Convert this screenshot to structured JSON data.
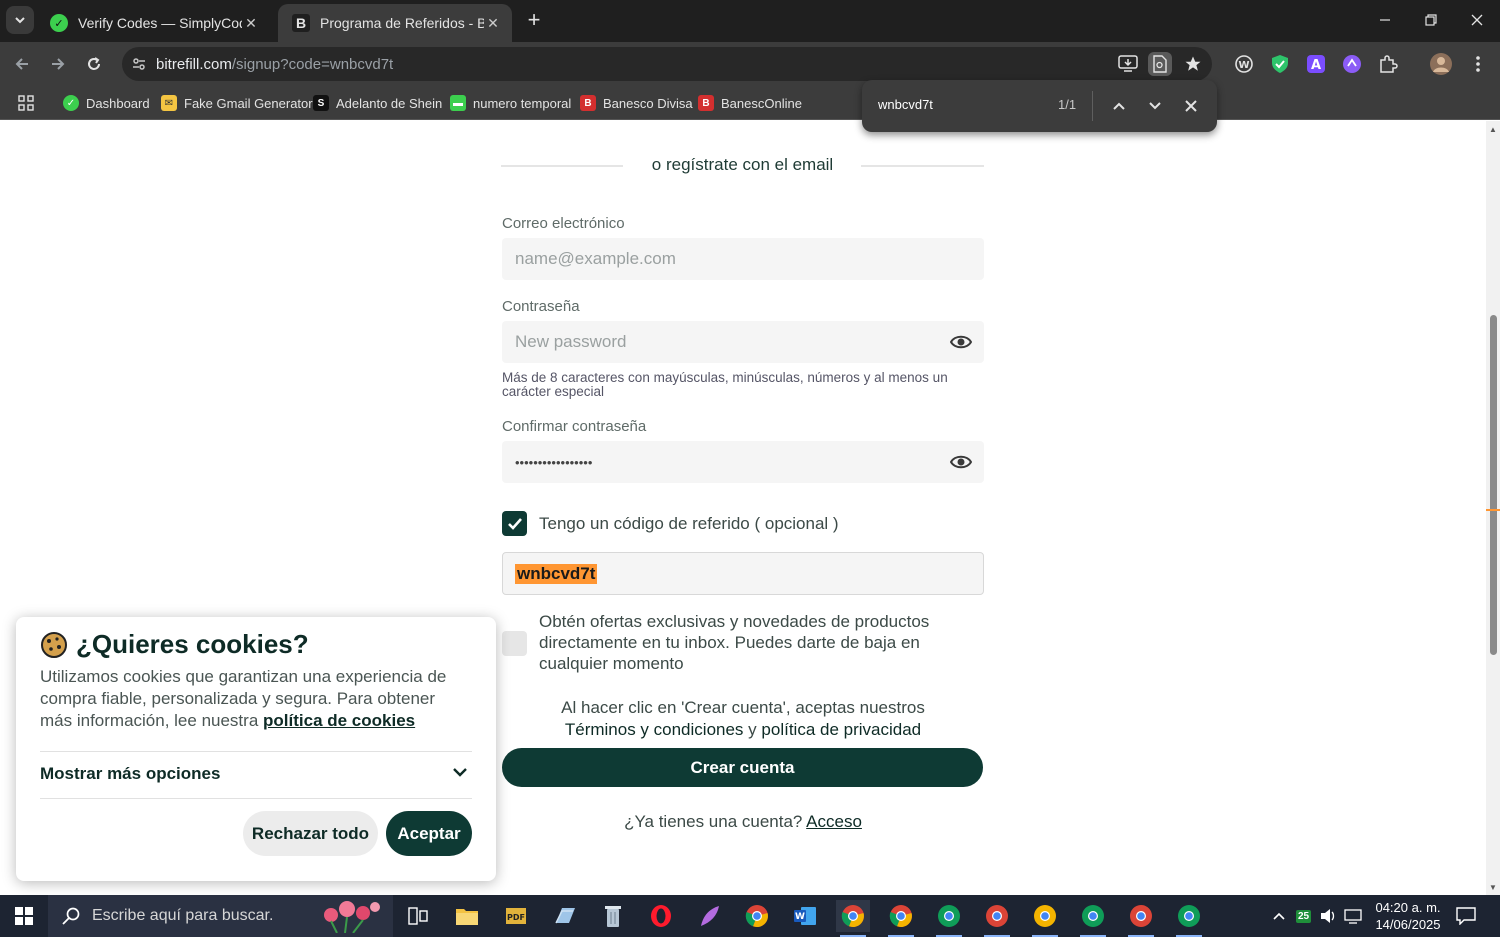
{
  "browser": {
    "tabs": [
      {
        "title": "Verify Codes — SimplyCodes",
        "favicon": "simplycodes-check-icon",
        "active": false
      },
      {
        "title": "Programa de Referidos - Bitrefill",
        "favicon": "bitrefill-b-icon",
        "active": true
      }
    ],
    "url_domain": "bitrefill.com",
    "url_path": "/signup?code=wnbcvd7t",
    "bookmarks": [
      "Dashboard",
      "Fake Gmail Generator",
      "Adelanto de Shein",
      "numero temporal",
      "Banesco Divisa",
      "BanescOnline"
    ],
    "find": {
      "query": "wnbcvd7t",
      "count": "1/1"
    }
  },
  "form": {
    "divider_text": "o regístrate con el email",
    "email_label": "Correo electrónico",
    "email_placeholder": "name@example.com",
    "password_label": "Contraseña",
    "password_placeholder": "New password",
    "password_hint": "Más de 8 caracteres con mayúsculas, minúsculas, números y al menos un carácter especial",
    "confirm_label": "Confirmar contraseña",
    "confirm_value": "•••••••••••••••••",
    "referral_checkbox_label": "Tengo un código de referido ( opcional )",
    "referral_checked": true,
    "referral_code": "wnbcvd7t",
    "newsletter_label": "Obtén ofertas exclusivas y novedades de productos directamente en tu inbox. Puedes darte de baja en cualquier momento",
    "newsletter_checked": false,
    "terms_prefix": "Al hacer clic en 'Crear cuenta', aceptas nuestros",
    "terms_link": "Términos y condiciones",
    "terms_and": "y",
    "privacy_link": "política de privacidad",
    "submit_label": "Crear cuenta",
    "login_prompt": "¿Ya tienes una cuenta?",
    "login_link": "Acceso"
  },
  "cookie": {
    "title": "¿Quieres cookies?",
    "body": "Utilizamos cookies que garantizan una experiencia de compra fiable, personalizada y segura. Para obtener más información, lee nuestra",
    "policy_link": "política de cookies",
    "more_options": "Mostrar más opciones",
    "reject_label": "Rechazar todo",
    "accept_label": "Aceptar"
  },
  "taskbar": {
    "search_placeholder": "Escribe aquí para buscar.",
    "time": "04:20 a. m.",
    "date": "14/06/2025",
    "tray_badge": "25"
  },
  "colors": {
    "brand_dark": "#0e3a34",
    "find_highlight": "#ff9632",
    "chrome_dark": "#3c3c3c"
  }
}
